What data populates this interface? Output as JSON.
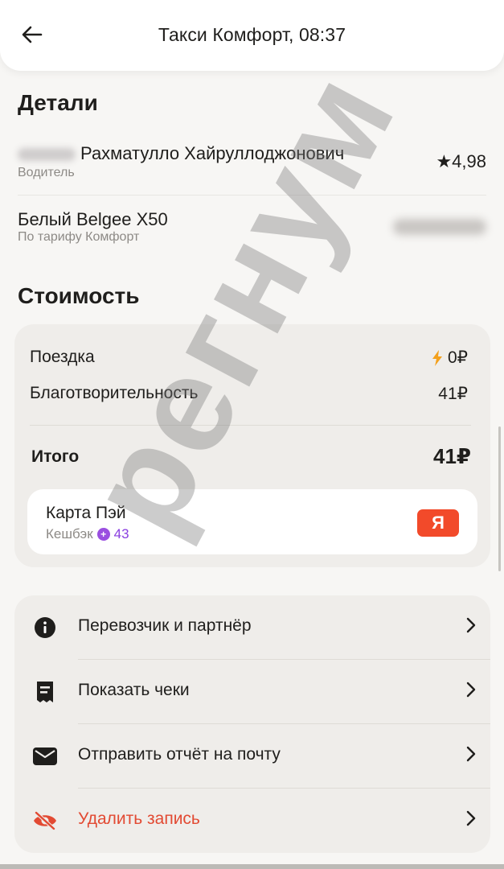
{
  "header": {
    "title": "Такси Комфорт, 08:37",
    "back_icon": "arrow-left-icon"
  },
  "details": {
    "title": "Детали",
    "driver": {
      "name": "Рахматулло Хайруллоджонович",
      "role": "Водитель",
      "rating": "4,98",
      "rating_icon": "star-icon"
    },
    "car": {
      "model": "Белый Belgee X50",
      "tariff": "По тарифу Комфорт"
    }
  },
  "cost": {
    "title": "Стоимость",
    "trip_label": "Поездка",
    "trip_value": "0₽",
    "trip_icon": "lightning-icon",
    "charity_label": "Благотворительность",
    "charity_value": "41₽",
    "total_label": "Итого",
    "total_value": "41₽",
    "payment": {
      "name": "Карта Пэй",
      "cashback_label": "Кешбэк",
      "cashback_value": "43",
      "badge": "Я",
      "badge_color": "#f24a2a",
      "cashback_color": "#8a3fe0"
    }
  },
  "menu": {
    "items": [
      {
        "label": "Перевозчик и партнёр",
        "icon": "info-icon"
      },
      {
        "label": "Показать чеки",
        "icon": "receipt-icon"
      },
      {
        "label": "Отправить отчёт на почту",
        "icon": "mail-icon"
      },
      {
        "label": "Удалить запись",
        "icon": "eye-off-icon",
        "color": "#e24a33"
      }
    ]
  },
  "watermark": "регнум"
}
